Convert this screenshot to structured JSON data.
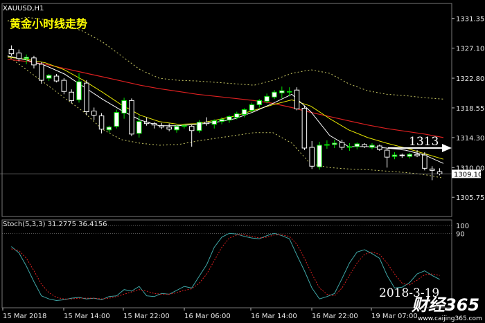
{
  "chart_data": [
    {
      "type": "candlestick",
      "symbol_label": "XAUUSD,H1",
      "title": "黄金小时线走势",
      "ylim": [
        1303.0,
        1333.5
      ],
      "y_ticks": [
        "1331.35",
        "1327.10",
        "1322.80",
        "1318.55",
        "1314.30",
        "1310.00",
        "1305.75"
      ],
      "current_price_label": "1309.10",
      "current_price": 1309.1,
      "x_tick_labels": [
        "15 Mar 2018",
        "15 Mar 14:00",
        "15 Mar 22:00",
        "16 Mar 06:00",
        "16 Mar 14:00",
        "16 Mar 22:00",
        "19 Mar 07:00"
      ],
      "annotation_label": "1313",
      "candles": [
        [
          1326.9,
          1327.5,
          1326.0,
          1326.3
        ],
        [
          1326.4,
          1326.9,
          1325.2,
          1325.6
        ],
        [
          1325.6,
          1326.2,
          1324.8,
          1325.8
        ],
        [
          1325.7,
          1326.0,
          1324.2,
          1324.7
        ],
        [
          1324.8,
          1325.1,
          1322.0,
          1322.5
        ],
        [
          1322.8,
          1323.4,
          1322.4,
          1323.2
        ],
        [
          1323.1,
          1323.4,
          1322.2,
          1322.4
        ],
        [
          1322.5,
          1322.8,
          1320.5,
          1320.9
        ],
        [
          1320.8,
          1321.2,
          1319.2,
          1319.6
        ],
        [
          1319.7,
          1323.5,
          1319.3,
          1322.3
        ],
        [
          1322.1,
          1322.5,
          1317.5,
          1318.0
        ],
        [
          1318.1,
          1318.6,
          1316.8,
          1317.5
        ],
        [
          1317.4,
          1317.8,
          1314.9,
          1315.5
        ],
        [
          1315.4,
          1316.0,
          1315.0,
          1315.8
        ],
        [
          1315.9,
          1318.3,
          1315.6,
          1317.9
        ],
        [
          1317.8,
          1320.0,
          1317.0,
          1319.6
        ],
        [
          1319.6,
          1319.9,
          1314.5,
          1314.8
        ],
        [
          1314.9,
          1317.4,
          1314.3,
          1316.6
        ],
        [
          1316.5,
          1317.2,
          1316.0,
          1316.3
        ],
        [
          1316.3,
          1316.5,
          1315.6,
          1316.1
        ],
        [
          1316.0,
          1316.4,
          1315.5,
          1315.8
        ],
        [
          1315.8,
          1316.3,
          1315.2,
          1315.5
        ],
        [
          1315.4,
          1316.1,
          1315.0,
          1315.9
        ],
        [
          1315.9,
          1316.2,
          1315.6,
          1316.0
        ],
        [
          1315.9,
          1316.1,
          1313.0,
          1315.3
        ],
        [
          1315.3,
          1316.8,
          1315.0,
          1316.5
        ],
        [
          1316.5,
          1317.2,
          1316.0,
          1316.3
        ],
        [
          1316.2,
          1316.9,
          1315.6,
          1316.7
        ],
        [
          1316.6,
          1317.2,
          1316.2,
          1316.9
        ],
        [
          1316.8,
          1317.5,
          1316.4,
          1317.3
        ],
        [
          1317.2,
          1318.0,
          1316.9,
          1317.7
        ],
        [
          1317.6,
          1318.5,
          1317.2,
          1318.3
        ],
        [
          1318.2,
          1319.3,
          1317.9,
          1319.0
        ],
        [
          1319.0,
          1319.8,
          1318.6,
          1319.6
        ],
        [
          1319.5,
          1320.6,
          1319.2,
          1320.2
        ],
        [
          1320.1,
          1321.1,
          1319.8,
          1320.8
        ],
        [
          1320.7,
          1321.6,
          1319.9,
          1321.0
        ],
        [
          1320.9,
          1321.5,
          1320.2,
          1320.9
        ],
        [
          1321.1,
          1321.5,
          1318.2,
          1318.4
        ],
        [
          1318.5,
          1318.9,
          1312.5,
          1312.8
        ],
        [
          1312.9,
          1313.8,
          1309.8,
          1310.2
        ],
        [
          1310.1,
          1313.7,
          1309.7,
          1313.2
        ],
        [
          1313.2,
          1313.9,
          1312.7,
          1313.3
        ],
        [
          1313.3,
          1314.0,
          1312.8,
          1313.5
        ],
        [
          1313.6,
          1314.0,
          1312.5,
          1312.9
        ],
        [
          1312.9,
          1313.5,
          1312.4,
          1313.0
        ],
        [
          1313.0,
          1313.6,
          1312.6,
          1313.4
        ],
        [
          1313.3,
          1313.5,
          1312.8,
          1313.0
        ],
        [
          1312.9,
          1313.5,
          1312.6,
          1313.2
        ],
        [
          1313.1,
          1313.3,
          1312.4,
          1312.6
        ],
        [
          1312.5,
          1312.8,
          1310.0,
          1311.5
        ],
        [
          1311.6,
          1312.2,
          1311.2,
          1311.8
        ],
        [
          1311.8,
          1312.0,
          1311.4,
          1311.7
        ],
        [
          1311.6,
          1312.1,
          1311.3,
          1311.9
        ],
        [
          1311.9,
          1312.5,
          1311.5,
          1311.7
        ],
        [
          1311.8,
          1312.2,
          1309.6,
          1309.9
        ],
        [
          1309.8,
          1310.2,
          1308.2,
          1309.6
        ],
        [
          1309.4,
          1309.9,
          1308.9,
          1309.1
        ]
      ],
      "bollinger_upper": [
        1331.0,
        1331.5,
        1331.2,
        1330.5,
        1329.5,
        1328.0,
        1326.0,
        1324.0,
        1322.8,
        1322.5,
        1322.4,
        1322.2,
        1322.0,
        1321.8,
        1322.5,
        1323.5,
        1324.0,
        1323.5,
        1322.0,
        1321.0,
        1320.5,
        1320.3,
        1320.0,
        1319.8
      ],
      "bollinger_lower": [
        1326.0,
        1324.0,
        1322.0,
        1320.0,
        1318.0,
        1315.5,
        1314.0,
        1313.5,
        1313.2,
        1313.3,
        1313.8,
        1314.2,
        1314.6,
        1315.0,
        1315.0,
        1313.5,
        1310.5,
        1310.0,
        1309.8,
        1309.7,
        1309.5,
        1309.3,
        1309.0,
        1308.5
      ],
      "ma_red": [
        1325.5,
        1325.2,
        1324.8,
        1324.2,
        1323.6,
        1323.0,
        1322.4,
        1321.8,
        1321.3,
        1320.9,
        1320.5,
        1320.2,
        1319.9,
        1319.6,
        1319.2,
        1318.6,
        1317.9,
        1317.3,
        1316.7,
        1316.1,
        1315.6,
        1315.2,
        1314.8,
        1314.3
      ],
      "ma_yellow": [
        1325.8,
        1325.5,
        1325.0,
        1324.0,
        1322.5,
        1320.8,
        1319.0,
        1317.5,
        1316.6,
        1316.2,
        1316.3,
        1316.8,
        1317.4,
        1318.2,
        1319.0,
        1319.7,
        1318.8,
        1317.0,
        1315.4,
        1314.3,
        1313.5,
        1312.8,
        1312.0,
        1311.2
      ],
      "ma_white": [
        1326.0,
        1325.4,
        1324.6,
        1323.4,
        1321.6,
        1319.8,
        1318.2,
        1316.8,
        1316.0,
        1316.0,
        1316.2,
        1316.5,
        1317.0,
        1318.0,
        1319.2,
        1320.5,
        1318.0,
        1314.6,
        1313.0,
        1313.0,
        1312.8,
        1312.5,
        1311.8,
        1310.6
      ]
    },
    {
      "type": "line",
      "title": "Stoch(5,3,3) 31.2775 36.4156",
      "ylim": [
        0,
        100
      ],
      "y_ticks": [
        "100",
        "90"
      ],
      "main": [
        73,
        65,
        48,
        28,
        10,
        6,
        4,
        5,
        7,
        8,
        6,
        7,
        5,
        9,
        10,
        18,
        16,
        22,
        10,
        9,
        13,
        12,
        17,
        22,
        20,
        35,
        50,
        72,
        85,
        90,
        89,
        86,
        84,
        83,
        87,
        90,
        87,
        83,
        62,
        42,
        20,
        6,
        9,
        13,
        32,
        52,
        66,
        69,
        64,
        58,
        36,
        20,
        21,
        27,
        38,
        42,
        36,
        31
      ],
      "signal": [
        70,
        68,
        58,
        42,
        25,
        14,
        8,
        6,
        6,
        7,
        7,
        7,
        6,
        7,
        9,
        12,
        15,
        18,
        16,
        13,
        12,
        12,
        14,
        17,
        19,
        26,
        38,
        55,
        72,
        84,
        88,
        88,
        86,
        84,
        85,
        88,
        88,
        86,
        76,
        58,
        38,
        20,
        12,
        10,
        20,
        36,
        52,
        63,
        66,
        63,
        52,
        38,
        26,
        24,
        30,
        37,
        38,
        36
      ]
    }
  ],
  "watermark": {
    "brand": "财经365",
    "url": "www.caijing365.com",
    "date": "2018-3-19"
  },
  "colors": {
    "candle_up": "#ffffff",
    "candle_down": "#000000",
    "bull_wick": "#00dd00",
    "bb": "#cccc66",
    "ma_red": "#dd2020",
    "ma_yellow": "#e6e600",
    "ma_white": "#ffffff",
    "stoch_main": "#3fa7a7",
    "stoch_signal": "#dd2020"
  }
}
